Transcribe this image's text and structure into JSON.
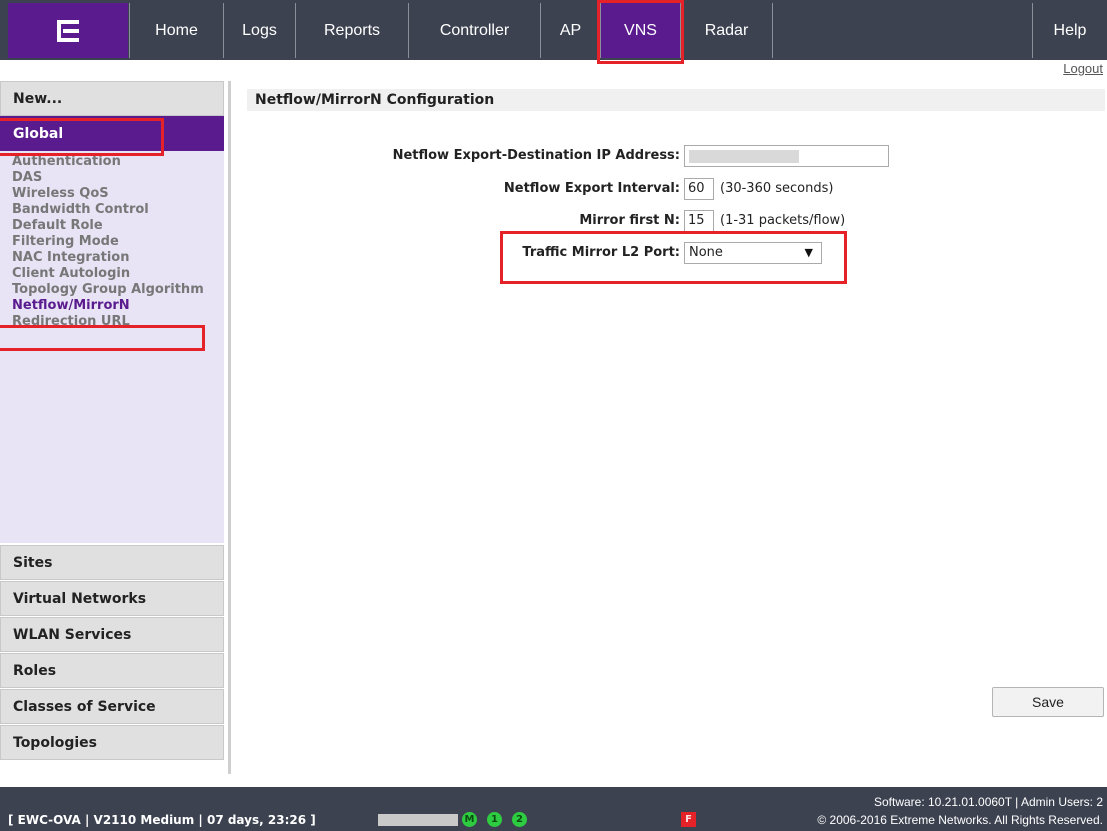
{
  "nav": {
    "tabs": [
      {
        "label": "Home"
      },
      {
        "label": "Logs"
      },
      {
        "label": "Reports"
      },
      {
        "label": "Controller"
      },
      {
        "label": "AP"
      },
      {
        "label": "VNS",
        "active": true
      },
      {
        "label": "Radar"
      }
    ],
    "help": "Help",
    "logout": "Logout",
    "logo_icon": "extreme-e-logo-icon"
  },
  "sidebar": {
    "new": "New...",
    "global": "Global",
    "items": [
      {
        "label": "Authentication"
      },
      {
        "label": "DAS"
      },
      {
        "label": "Wireless QoS"
      },
      {
        "label": "Bandwidth Control"
      },
      {
        "label": "Default Role"
      },
      {
        "label": "Filtering Mode"
      },
      {
        "label": "NAC Integration"
      },
      {
        "label": "Client Autologin"
      },
      {
        "label": "Topology Group Algorithm"
      },
      {
        "label": "Netflow/MirrorN",
        "active": true
      },
      {
        "label": "Redirection URL"
      }
    ],
    "sections": [
      {
        "label": "Sites"
      },
      {
        "label": "Virtual Networks"
      },
      {
        "label": "WLAN Services"
      },
      {
        "label": "Roles"
      },
      {
        "label": "Classes of Service"
      },
      {
        "label": "Topologies"
      }
    ]
  },
  "main": {
    "title": "Netflow/MirrorN Configuration",
    "fields": {
      "ip_label": "Netflow Export-Destination IP Address:",
      "ip_value": "",
      "interval_label": "Netflow Export Interval:",
      "interval_value": "60",
      "interval_hint": "(30-360 seconds)",
      "mirror_label": "Mirror first N:",
      "mirror_value": "15",
      "mirror_hint": "(1-31 packets/flow)",
      "l2port_label": "Traffic Mirror L2 Port:",
      "l2port_value": "None"
    },
    "save": "Save"
  },
  "footer": {
    "left": "[ EWC-OVA | V2110 Medium | 07 days, 23:26 ]",
    "status": [
      "M",
      "1",
      "2"
    ],
    "flag": "F",
    "software": "Software: 10.21.01.0060T | Admin Users: 2",
    "copyright": "© 2006-2016  Extreme Networks. All Rights Reserved."
  },
  "colors": {
    "nav_bg": "#3c4250",
    "brand_purple": "#5a1b8e",
    "highlight_red": "#e52228",
    "sidebar_panel": "#e8e4f6"
  }
}
